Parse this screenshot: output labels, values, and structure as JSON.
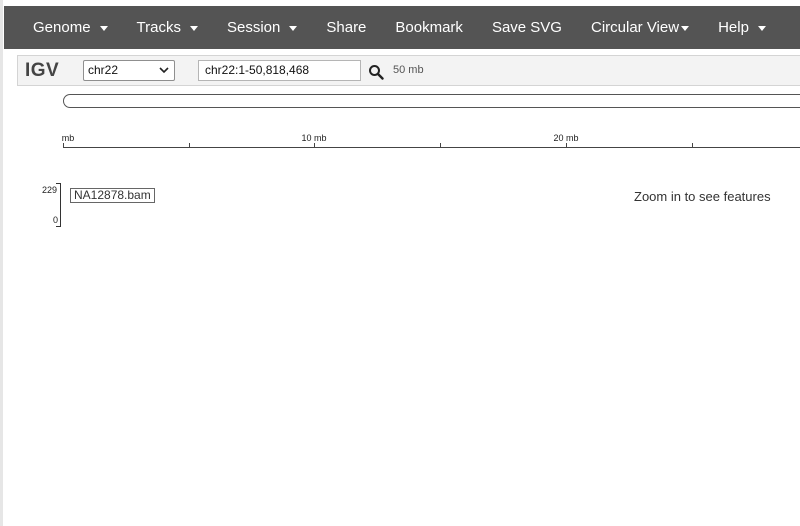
{
  "nav": {
    "items": [
      {
        "label": "Genome",
        "dropdown": true
      },
      {
        "label": "Tracks",
        "dropdown": true
      },
      {
        "label": "Session",
        "dropdown": true
      },
      {
        "label": "Share",
        "dropdown": false
      },
      {
        "label": "Bookmark",
        "dropdown": false
      },
      {
        "label": "Save SVG",
        "dropdown": false
      },
      {
        "label": "Circular View",
        "dropdown": true
      },
      {
        "label": "Help",
        "dropdown": true
      }
    ]
  },
  "toolbar": {
    "logo": "IGV",
    "chromosome": "chr22",
    "locus": "chr22:1-50,818,468",
    "window_size": "50 mb"
  },
  "ruler": {
    "labels": [
      "mb",
      "10 mb",
      "20 mb"
    ]
  },
  "track": {
    "name": "NA12878.bam",
    "scale_max": "229",
    "scale_min": "0",
    "message": "Zoom in to see features"
  },
  "colors": {
    "navbar": "#545454",
    "toolbar_bg": "#f3f3f3"
  }
}
